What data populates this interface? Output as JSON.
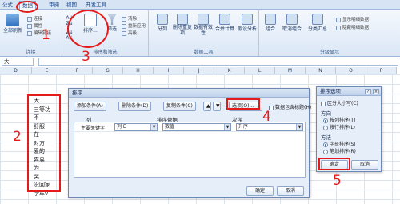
{
  "ribbon": {
    "tabs": [
      "公式",
      "数据",
      "审阅",
      "视图",
      "开发工具"
    ],
    "active_tab": "数据",
    "refresh_group": {
      "button": "全部刷新",
      "items": [
        "连接",
        "属性",
        "编辑链接"
      ],
      "label": "连接"
    },
    "sort_group": {
      "sort_button": "排序...",
      "filter_button": "筛选",
      "items": [
        "清除",
        "重新应用",
        "高级"
      ],
      "label": "排序和筛选"
    },
    "tools_group": {
      "buttons": [
        "分列",
        "删除重复项",
        "数据有效性",
        "合并计算",
        "假设分析"
      ],
      "label": "数据工具"
    },
    "outline_group": {
      "buttons": [
        "组合",
        "取消组合",
        "分类汇总"
      ],
      "items": [
        "显示明细数据",
        "隐藏明细数据"
      ],
      "label": "分级显示"
    }
  },
  "formula_bar": {
    "name_box": "大",
    "formula": ""
  },
  "grid": {
    "columns": [
      "D",
      "E",
      "F",
      "G",
      "H",
      "I",
      "J",
      "K",
      "L",
      "M",
      "N",
      "O",
      "P"
    ],
    "cells": [
      "大",
      "三等功",
      "不",
      "舒服",
      "在",
      "对方",
      "爱的",
      "容易",
      "为",
      "哭",
      "没回家",
      "学车v"
    ]
  },
  "sort_dialog": {
    "title": "排序",
    "add_level": "添加条件(A)",
    "delete_level": "删除条件(D)",
    "copy_level": "复制条件(C)",
    "options_button": "选项(O)...",
    "has_header_label": "数据包含标题(H)",
    "col_header": "列",
    "sorton_header": "排序依据",
    "order_header": "次序",
    "row_label": "主要关键字",
    "row_column": "列 E",
    "row_sorton": "数值",
    "row_order": "升序",
    "ok": "确定",
    "cancel": "取消"
  },
  "options_dialog": {
    "title": "排序选项",
    "case_label": "区分大小写(C)",
    "direction_label": "方向",
    "dir_options": [
      "按列排序(T)",
      "按行排序(L)"
    ],
    "method_label": "方法",
    "method_options": [
      "字母排序(S)",
      "笔划排序(R)"
    ],
    "ok": "确定",
    "cancel": "取消"
  },
  "annotations": {
    "step1": "1",
    "step2": "2",
    "step3": "3",
    "step4": "4",
    "step5": "5"
  },
  "colors": {
    "annotation": "#e41b1b",
    "ribbon": "#dbe7f6",
    "dialog": "#e6eefa"
  }
}
